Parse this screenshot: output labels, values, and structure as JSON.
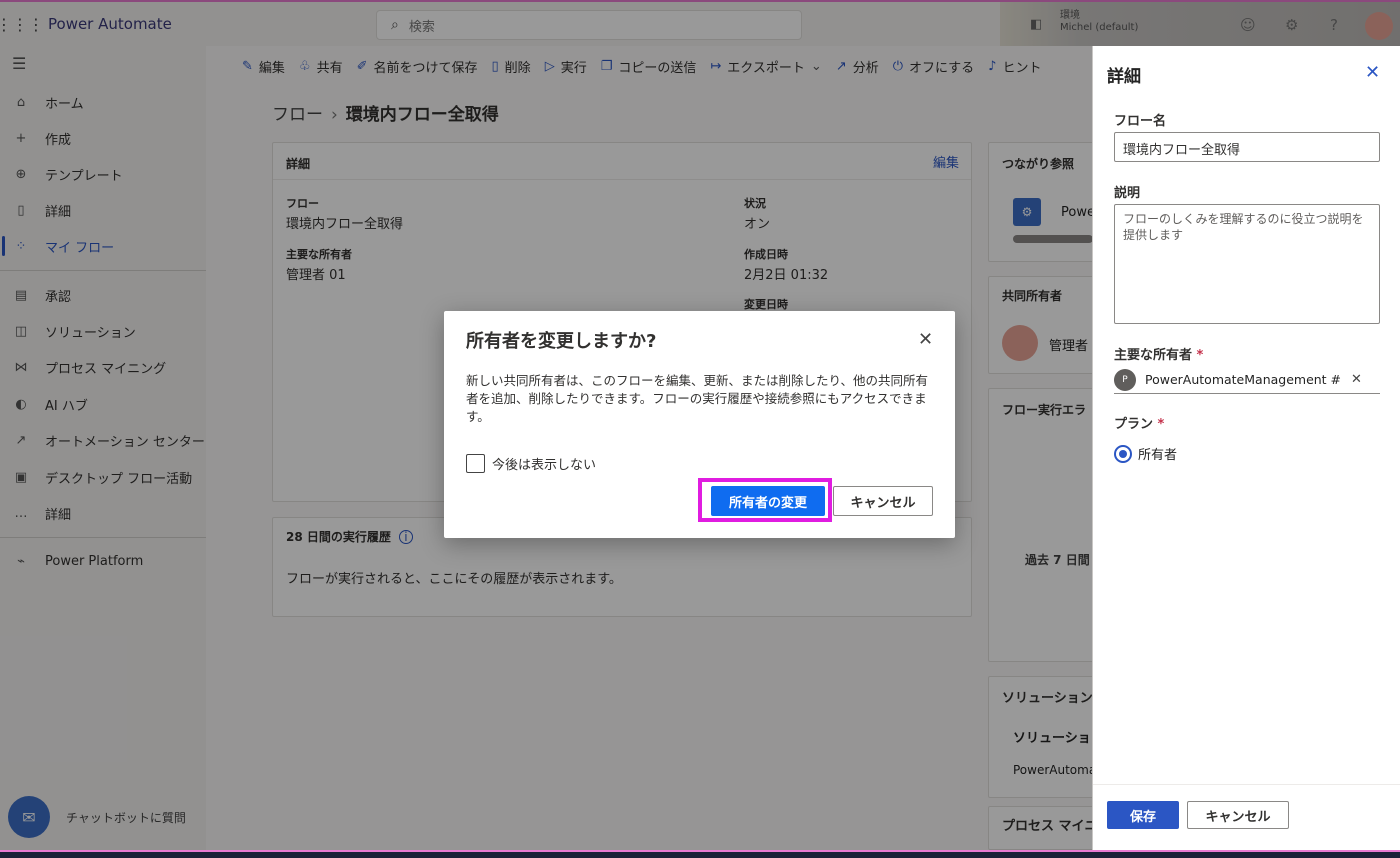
{
  "header": {
    "app_name": "Power Automate",
    "search_placeholder": "検索",
    "environment_line1": "環境",
    "environment_line2": "Michel (default)"
  },
  "sidebar": {
    "items": [
      {
        "label": "ホーム",
        "icon": "home-icon"
      },
      {
        "label": "作成",
        "icon": "plus-icon"
      },
      {
        "label": "テンプレート",
        "icon": "template-icon"
      },
      {
        "label": "詳細",
        "icon": "book-icon"
      },
      {
        "label": "マイ フロー",
        "icon": "flow-icon",
        "active": true
      },
      {
        "label": "承認",
        "icon": "approval-icon"
      },
      {
        "label": "ソリューション",
        "icon": "solution-icon"
      },
      {
        "label": "プロセス マイニング",
        "icon": "process-mining-icon"
      },
      {
        "label": "AI ハブ",
        "icon": "ai-hub-icon"
      },
      {
        "label": "オートメーション センター",
        "icon": "automation-center-icon"
      },
      {
        "label": "デスクトップ フロー活動",
        "icon": "desktop-flow-icon"
      },
      {
        "label": "詳細",
        "icon": "more-icon"
      },
      {
        "label": "Power Platform",
        "icon": "power-platform-icon"
      }
    ],
    "chatbot_label": "チャットボットに質問"
  },
  "commandbar": {
    "edit": "編集",
    "share": "共有",
    "save_as": "名前をつけて保存",
    "delete": "削除",
    "run": "実行",
    "send_copy": "コピーの送信",
    "export": "エクスポート",
    "analytics": "分析",
    "turn_off": "オフにする",
    "hint": "ヒント"
  },
  "breadcrumb": {
    "root": "フロー",
    "current": "環境内フロー全取得"
  },
  "details_card": {
    "title": "詳細",
    "edit_link": "編集",
    "flow_label": "フロー",
    "flow_value": "環境内フロー全取得",
    "owner_label": "主要な所有者",
    "owner_value": "管理者 01",
    "status_label": "状況",
    "status_value": "オン",
    "created_label": "作成日時",
    "created_value": "2月2日 01:32",
    "modified_label": "変更日時"
  },
  "history_card": {
    "title": "28 日間の実行履歴",
    "empty_text": "フローが実行されると、ここにその履歴が表示されます。"
  },
  "right_cards": {
    "connections_title": "つながり参照",
    "connection_name": "Powe",
    "coowners_title": "共同所有者",
    "coowner_name": "管理者",
    "run_errors_title": "フロー実行エラ",
    "past7days": "過去 7 日間",
    "solutions_title": "ソリューション",
    "solutions_col": "ソリューショ",
    "solutions_item": "PowerAutoma",
    "process_mining_title": "プロセス マイニ"
  },
  "panel": {
    "title": "詳細",
    "flow_name_label": "フロー名",
    "flow_name_value": "環境内フロー全取得",
    "description_label": "説明",
    "description_placeholder": "フローのしくみを理解するのに役立つ説明を提供します",
    "primary_owner_label": "主要な所有者",
    "required_mark": "*",
    "owner_initial": "P",
    "owner_value": "PowerAutomateManagement #",
    "plan_label": "プラン",
    "plan_option": "所有者",
    "save_label": "保存",
    "cancel_label": "キャンセル"
  },
  "dialog": {
    "title": "所有者を変更しますか?",
    "body": "新しい共同所有者は、このフローを編集、更新、または削除したり、他の共同所有者を追加、削除したりできます。フローの実行履歴や接続参照にもアクセスできます。",
    "checkbox_label": "今後は表示しない",
    "confirm_label": "所有者の変更",
    "cancel_label": "キャンセル"
  },
  "colors": {
    "accent": "#2b56c4",
    "highlight": "#e01ce0"
  }
}
